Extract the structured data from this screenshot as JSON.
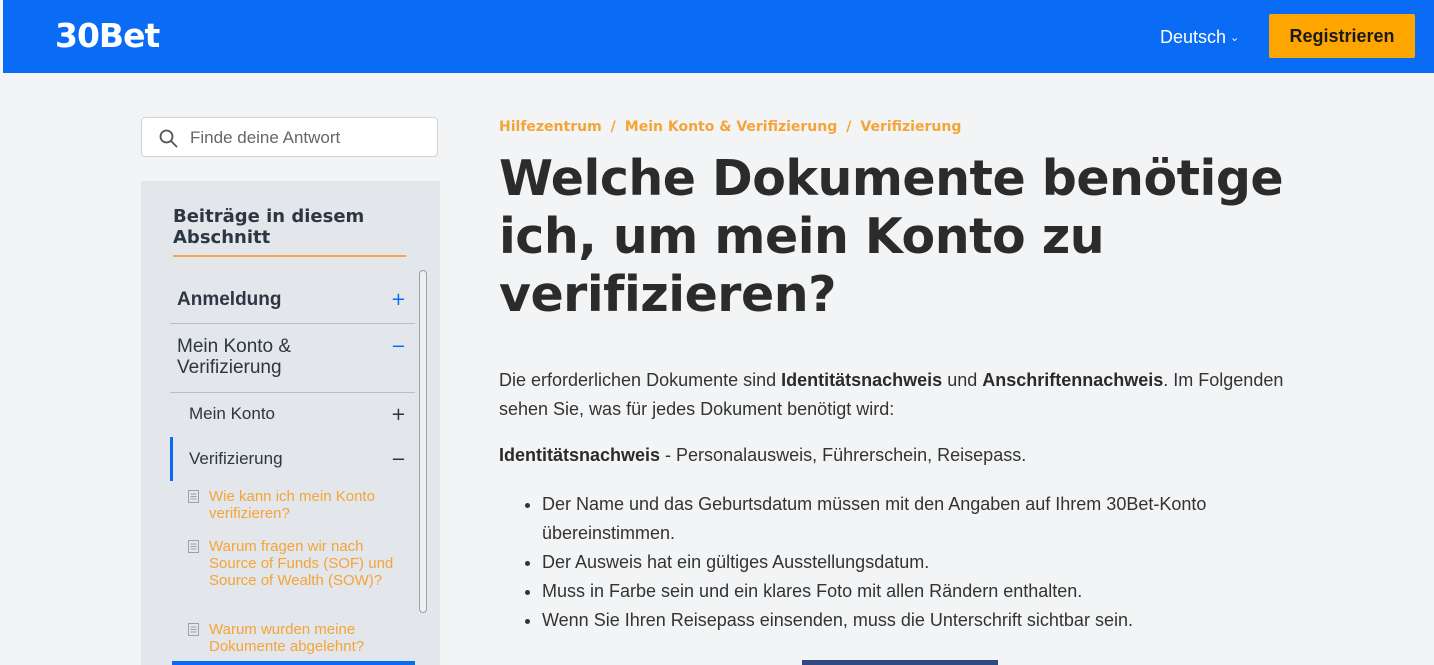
{
  "header": {
    "logo": "30Bet",
    "language": "Deutsch",
    "register_label": "Registrieren"
  },
  "search": {
    "placeholder": "Finde deine Antwort"
  },
  "sidebar": {
    "title": "Beiträge in diesem Abschnitt",
    "sections": [
      {
        "label": "Anmeldung",
        "sign": "+"
      },
      {
        "label": "Mein Konto & Verifizierung",
        "sign": "−"
      }
    ],
    "subsections": [
      {
        "label": "Mein Konto",
        "sign": "+"
      },
      {
        "label": "Verifizierung",
        "sign": "−"
      }
    ],
    "articles": [
      "Wie kann ich mein Konto verifizieren?",
      "Warum fragen wir nach Source of Funds (SOF) und Source of Wealth (SOW)?",
      "Warum wurden meine Dokumente abgelehnt?"
    ]
  },
  "breadcrumb": [
    "Hilfezentrum",
    "Mein Konto & Verifizierung",
    "Verifizierung"
  ],
  "article": {
    "title": "Welche Dokumente benötige ich, um mein Konto zu verifizieren?",
    "intro_1": "Die erforderlichen Dokumente sind ",
    "intro_bold_1": "Identitätsnachweis",
    "intro_2": " und ",
    "intro_bold_2": "Anschriftennachweis",
    "intro_3": ". Im Folgenden sehen Sie, was für jedes Dokument benötigt wird:",
    "id_heading": "Identitätsnachweis",
    "id_text": " - Personalausweis, Führerschein, Reisepass.",
    "bullets": [
      "Der Name und das Geburtsdatum müssen mit den Angaben auf Ihrem 30Bet-Konto übereinstimmen.",
      "Der Ausweis hat ein gültiges Ausstellungsdatum.",
      "Muss in Farbe sein und ein klares Foto mit allen Rändern enthalten.",
      "Wenn Sie Ihren Reisepass einsenden, muss die Unterschrift sichtbar sein."
    ]
  },
  "colors": {
    "header_bg": "#0a6cf5",
    "accent_orange": "#ffa500",
    "link_orange": "#f5a437",
    "sidebar_bg": "#e3e6ea"
  }
}
